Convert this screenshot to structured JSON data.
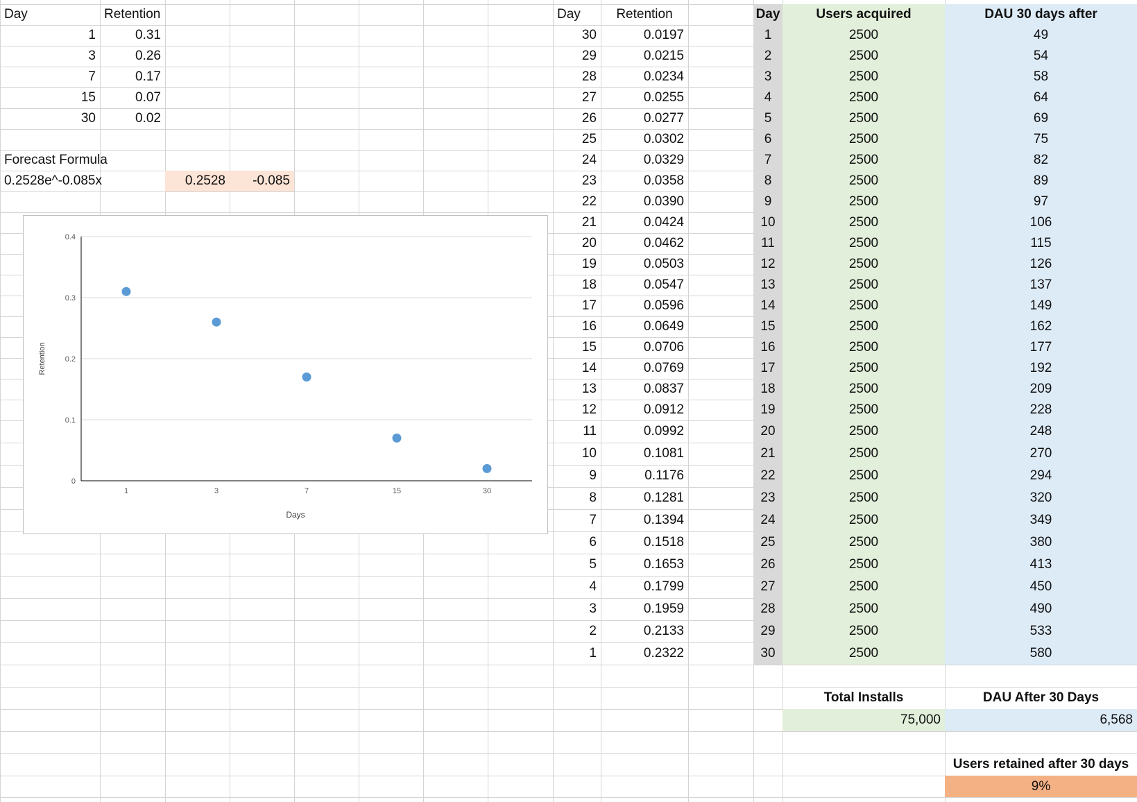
{
  "sheet": {
    "left_header": {
      "day": "Day",
      "retention": "Retention"
    },
    "left_rows": [
      {
        "day": "1",
        "retention": "0.31"
      },
      {
        "day": "3",
        "retention": "0.26"
      },
      {
        "day": "7",
        "retention": "0.17"
      },
      {
        "day": "15",
        "retention": "0.07"
      },
      {
        "day": "30",
        "retention": "0.02"
      }
    ],
    "forecast_label": "Forecast Formula",
    "forecast_formula": "0.2528e^-0.085x",
    "coef_a": "0.2528",
    "coef_b": "-0.085",
    "mid_header": {
      "day": "Day",
      "retention": "Retention"
    },
    "mid_rows": [
      {
        "day": "30",
        "retention": "0.0197"
      },
      {
        "day": "29",
        "retention": "0.0215"
      },
      {
        "day": "28",
        "retention": "0.0234"
      },
      {
        "day": "27",
        "retention": "0.0255"
      },
      {
        "day": "26",
        "retention": "0.0277"
      },
      {
        "day": "25",
        "retention": "0.0302"
      },
      {
        "day": "24",
        "retention": "0.0329"
      },
      {
        "day": "23",
        "retention": "0.0358"
      },
      {
        "day": "22",
        "retention": "0.0390"
      },
      {
        "day": "21",
        "retention": "0.0424"
      },
      {
        "day": "20",
        "retention": "0.0462"
      },
      {
        "day": "19",
        "retention": "0.0503"
      },
      {
        "day": "18",
        "retention": "0.0547"
      },
      {
        "day": "17",
        "retention": "0.0596"
      },
      {
        "day": "16",
        "retention": "0.0649"
      },
      {
        "day": "15",
        "retention": "0.0706"
      },
      {
        "day": "14",
        "retention": "0.0769"
      },
      {
        "day": "13",
        "retention": "0.0837"
      },
      {
        "day": "12",
        "retention": "0.0912"
      },
      {
        "day": "11",
        "retention": "0.0992"
      },
      {
        "day": "10",
        "retention": "0.1081"
      },
      {
        "day": "9",
        "retention": "0.1176"
      },
      {
        "day": "8",
        "retention": "0.1281"
      },
      {
        "day": "7",
        "retention": "0.1394"
      },
      {
        "day": "6",
        "retention": "0.1518"
      },
      {
        "day": "5",
        "retention": "0.1653"
      },
      {
        "day": "4",
        "retention": "0.1799"
      },
      {
        "day": "3",
        "retention": "0.1959"
      },
      {
        "day": "2",
        "retention": "0.2133"
      },
      {
        "day": "1",
        "retention": "0.2322"
      }
    ],
    "right_header": {
      "day": "Day",
      "users": "Users acquired",
      "dau": "DAU 30 days after"
    },
    "right_rows": [
      {
        "day": "1",
        "users": "2500",
        "dau": "49"
      },
      {
        "day": "2",
        "users": "2500",
        "dau": "54"
      },
      {
        "day": "3",
        "users": "2500",
        "dau": "58"
      },
      {
        "day": "4",
        "users": "2500",
        "dau": "64"
      },
      {
        "day": "5",
        "users": "2500",
        "dau": "69"
      },
      {
        "day": "6",
        "users": "2500",
        "dau": "75"
      },
      {
        "day": "7",
        "users": "2500",
        "dau": "82"
      },
      {
        "day": "8",
        "users": "2500",
        "dau": "89"
      },
      {
        "day": "9",
        "users": "2500",
        "dau": "97"
      },
      {
        "day": "10",
        "users": "2500",
        "dau": "106"
      },
      {
        "day": "11",
        "users": "2500",
        "dau": "115"
      },
      {
        "day": "12",
        "users": "2500",
        "dau": "126"
      },
      {
        "day": "13",
        "users": "2500",
        "dau": "137"
      },
      {
        "day": "14",
        "users": "2500",
        "dau": "149"
      },
      {
        "day": "15",
        "users": "2500",
        "dau": "162"
      },
      {
        "day": "16",
        "users": "2500",
        "dau": "177"
      },
      {
        "day": "17",
        "users": "2500",
        "dau": "192"
      },
      {
        "day": "18",
        "users": "2500",
        "dau": "209"
      },
      {
        "day": "19",
        "users": "2500",
        "dau": "228"
      },
      {
        "day": "20",
        "users": "2500",
        "dau": "248"
      },
      {
        "day": "21",
        "users": "2500",
        "dau": "270"
      },
      {
        "day": "22",
        "users": "2500",
        "dau": "294"
      },
      {
        "day": "23",
        "users": "2500",
        "dau": "320"
      },
      {
        "day": "24",
        "users": "2500",
        "dau": "349"
      },
      {
        "day": "25",
        "users": "2500",
        "dau": "380"
      },
      {
        "day": "26",
        "users": "2500",
        "dau": "413"
      },
      {
        "day": "27",
        "users": "2500",
        "dau": "450"
      },
      {
        "day": "28",
        "users": "2500",
        "dau": "490"
      },
      {
        "day": "29",
        "users": "2500",
        "dau": "533"
      },
      {
        "day": "30",
        "users": "2500",
        "dau": "580"
      }
    ],
    "total_installs_label": "Total Installs",
    "total_installs_value": "75,000",
    "dau_after_label": "DAU After 30 Days",
    "dau_after_value": "6,568",
    "retained_label": "Users retained after 30 days",
    "retained_value": "9%"
  },
  "colors": {
    "peach": "#fce4d6",
    "orange": "#f4b183",
    "green": "#e2efda",
    "blue": "#ddebf7",
    "gray": "#d9d9d9",
    "marker": "#5b9bd5"
  },
  "chart_data": {
    "type": "scatter",
    "categories": [
      "1",
      "3",
      "7",
      "15",
      "30"
    ],
    "values": [
      0.31,
      0.26,
      0.17,
      0.07,
      0.02
    ],
    "xlabel": "Days",
    "ylabel": "Retention",
    "ylim": [
      0,
      0.4
    ],
    "yticks": [
      "0",
      "0.1",
      "0.2",
      "0.3",
      "0.4"
    ],
    "grid": true,
    "legend": "none"
  }
}
